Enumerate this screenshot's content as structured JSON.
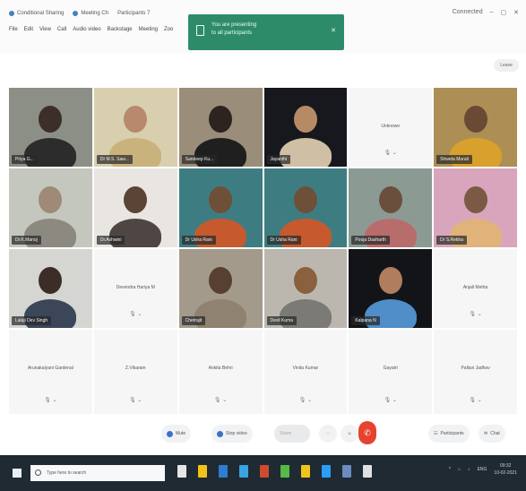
{
  "window": {
    "tabs": [
      {
        "label": "Conditional Sharing"
      },
      {
        "label": "Meeting Ch"
      },
      {
        "label": "Participants 7"
      }
    ],
    "menu": [
      "File",
      "Edit",
      "View",
      "Call",
      "Audio video",
      "Backstage",
      "Meeting",
      "Zoo"
    ],
    "controls": [
      "–",
      "▢",
      "✕"
    ],
    "status_label": "Connected"
  },
  "share_banner": {
    "line1": "You are presenting",
    "line2": "to all participants",
    "close": "✕"
  },
  "leave_chip": {
    "label": "Leave"
  },
  "participants": [
    {
      "name": "Priya G...",
      "kind": "video",
      "bg": "#8c8f86",
      "skin": "#3c2f2a",
      "shirt": "#2c2c2c"
    },
    {
      "name": "Dr M.S. Saw...",
      "kind": "video",
      "bg": "#d8cfae",
      "skin": "#b8896c",
      "shirt": "#c9b27c"
    },
    {
      "name": "Sandeep Ku...",
      "kind": "video",
      "bg": "#9a8d79",
      "skin": "#2d2420",
      "shirt": "#1f1f1f"
    },
    {
      "name": "Jayanthi",
      "kind": "video",
      "bg": "#16181d",
      "skin": "#b78a66",
      "shirt": "#cfbfa4"
    },
    {
      "name": "Unknown",
      "kind": "avatar",
      "mic": "🎙 ⌄"
    },
    {
      "name": "Shweta Murali",
      "kind": "video",
      "bg": "#ad8f55",
      "skin": "#6a4a34",
      "shirt": "#d8a02c"
    },
    {
      "name": "Dr.K.Manoj",
      "kind": "video",
      "bg": "#c4c7bd",
      "skin": "#9e8a76",
      "shirt": "#8c8a80"
    },
    {
      "name": "Dr.Ashwini",
      "kind": "video",
      "bg": "#e9e6e2",
      "skin": "#5a4436",
      "shirt": "#4f4644"
    },
    {
      "name": "Dr Usha Rani",
      "kind": "video",
      "bg": "#3d7d82",
      "skin": "#6e5038",
      "shirt": "#c65a2e"
    },
    {
      "name": "Dr Usha Rani",
      "kind": "video",
      "bg": "#3d7d82",
      "skin": "#6e5038",
      "shirt": "#c65a2e"
    },
    {
      "name": "Pooja Dasharth",
      "kind": "video",
      "bg": "#8c9a94",
      "skin": "#6b4f3d",
      "shirt": "#b86d6d"
    },
    {
      "name": "Dr S.Rekha",
      "kind": "video",
      "bg": "#d9a5bc",
      "skin": "#7b5a45",
      "shirt": "#e0b37a"
    },
    {
      "name": "Lalaji Dev Singh",
      "kind": "video",
      "bg": "#d5d6d2",
      "skin": "#3c2e27",
      "shirt": "#3b4659"
    },
    {
      "name": "Devendra Hariya M",
      "kind": "avatar",
      "mic": "🎙 ⌄"
    },
    {
      "name": "Chetrajit",
      "kind": "video",
      "bg": "#a39a8b",
      "skin": "#584030",
      "shirt": "#8f8270"
    },
    {
      "name": "Devil Kuma",
      "kind": "video",
      "bg": "#bbb7ae",
      "skin": "#8a603f",
      "shirt": "#7b7a74"
    },
    {
      "name": "Kalpana N",
      "kind": "video",
      "bg": "#131418",
      "skin": "#b07d5f",
      "shirt": "#4f8ec8"
    },
    {
      "name": "Anjali Mehta",
      "kind": "avatar",
      "mic": "🎙 ⌄"
    },
    {
      "name": "Arunakalyani Gardenal",
      "kind": "avatar",
      "mic": "🎙 ⌄"
    },
    {
      "name": "Z.Vikaram",
      "kind": "avatar",
      "mic": "🎙 ⌄"
    },
    {
      "name": "Ankita Behri",
      "kind": "avatar",
      "mic": "🎙 ⌄"
    },
    {
      "name": "Vinita Kumar",
      "kind": "avatar",
      "mic": "🎙 ⌄"
    },
    {
      "name": "Gayatri",
      "kind": "avatar",
      "mic": "🎙 ⌄"
    },
    {
      "name": "Pallavi Jadhav",
      "kind": "avatar",
      "mic": "🎙 ⌄"
    }
  ],
  "meeting_controls": {
    "mute": "Mute",
    "stop_video": "Stop video",
    "share": "Share",
    "more": "⋯",
    "end": "✆",
    "participants": "Participants",
    "chat": "Chat"
  },
  "taskbar": {
    "search_placeholder": "Type here to search",
    "app_colors": [
      "#e6e6e6",
      "#f0c419",
      "#2d7dd2",
      "#3aa3e3",
      "#d04a2f",
      "#57b947",
      "#f0c419",
      "#2a9df4",
      "#6a8cbf",
      "#e0e0e0"
    ],
    "tray_icons": [
      "^",
      "⌂",
      "♪",
      "ENG"
    ],
    "time": "09:32",
    "date": "10-02-2021"
  }
}
